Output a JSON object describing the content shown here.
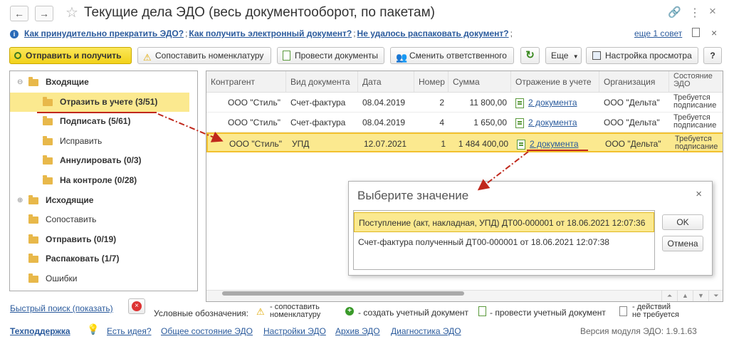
{
  "window": {
    "title": "Текущие дела ЭДО (весь документооборот, по пакетам)",
    "back": "←",
    "forward": "→",
    "more": "⋮",
    "close": "×"
  },
  "help_links": {
    "link1": "Как принудительно прекратить ЭДО?",
    "link2": "Как получить электронный документ?",
    "link3": "Не удалось распаковать документ?",
    "separator": ";",
    "more_advice": "еще 1 совет"
  },
  "toolbar": {
    "send_receive": "Отправить и получить",
    "match_nomenclature": "Сопоставить номенклатуру",
    "post_documents": "Провести документы",
    "change_responsible": "Сменить ответственного",
    "more": "Еще",
    "view_settings": "Настройка просмотра",
    "help": "?"
  },
  "tree": [
    {
      "label": "Входящие",
      "bold": true,
      "level": 0,
      "expand": "⊖"
    },
    {
      "label": "Отразить в учете (3/51)",
      "bold": true,
      "level": 1,
      "selected": true
    },
    {
      "label": "Подписать (5/61)",
      "bold": true,
      "level": 1
    },
    {
      "label": "Исправить",
      "bold": false,
      "level": 1
    },
    {
      "label": "Аннулировать (0/3)",
      "bold": true,
      "level": 1
    },
    {
      "label": "На контроле (0/28)",
      "bold": true,
      "level": 1
    },
    {
      "label": "Исходящие",
      "bold": true,
      "level": 0,
      "expand": "⊕"
    },
    {
      "label": "Сопоставить",
      "bold": false,
      "level": 0
    },
    {
      "label": "Отправить (0/19)",
      "bold": true,
      "level": 0
    },
    {
      "label": "Распаковать (1/7)",
      "bold": true,
      "level": 0
    },
    {
      "label": "Ошибки",
      "bold": false,
      "level": 0
    }
  ],
  "grid": {
    "columns": [
      "Контрагент",
      "Вид документа",
      "Дата",
      "Номер",
      "Сумма",
      "Отражение в учете",
      "Организация",
      "Состояние ЭДО"
    ],
    "rows": [
      {
        "counterparty": "ООО \"Стиль\"",
        "doc_type": "Счет-фактура",
        "date": "08.04.2019",
        "number": "2",
        "sum": "11 800,00",
        "accounting": "2 документа",
        "org": "ООО \"Дельта\"",
        "state": "Требуется подписание"
      },
      {
        "counterparty": "ООО \"Стиль\"",
        "doc_type": "Счет-фактура",
        "date": "08.04.2019",
        "number": "4",
        "sum": "1 650,00",
        "accounting": "2 документа",
        "org": "ООО \"Дельта\"",
        "state": "Требуется подписание"
      },
      {
        "counterparty": "ООО \"Стиль\"",
        "doc_type": "УПД",
        "date": "12.07.2021",
        "number": "1",
        "sum": "1 484 400,00",
        "accounting": "2 документа",
        "org": "ООО \"Дельта\"",
        "state": "Требуется подписание",
        "selected": true
      }
    ]
  },
  "dialog": {
    "title": "Выберите значение",
    "close": "×",
    "options": [
      "Поступление (акт, накладная, УПД) ДТ00-000001 от 18.06.2021 12:07:36",
      "Счет-фактура полученный ДТ00-000001 от 18.06.2021 12:07:38"
    ],
    "ok": "OK",
    "cancel": "Отмена"
  },
  "bottom": {
    "quick_search": "Быстрый поиск (показать)",
    "legend_label": "Условные обозначения:",
    "legend_match": "- сопоставить номенклатуру",
    "legend_match_l1": "- сопоставить",
    "legend_match_l2": "номенклатуру",
    "legend_create": "- создать учетный документ",
    "legend_post": "- провести учетный документ",
    "legend_none_l1": "- действий",
    "legend_none_l2": "не требуется"
  },
  "footer": {
    "support": "Техподдержка",
    "ideas": "Есть идея?",
    "state": "Общее состояние ЭДО",
    "settings": "Настройки ЭДО",
    "archive": "Архив ЭДО",
    "diagnostics": "Диагностика ЭДО",
    "version": "Версия модуля ЭДО: 1.9.1.63"
  },
  "colors": {
    "accent_yellow": "#f2d21a",
    "selection": "#fbe98f",
    "link": "#2a5a9c",
    "arrow": "#c0281c"
  }
}
